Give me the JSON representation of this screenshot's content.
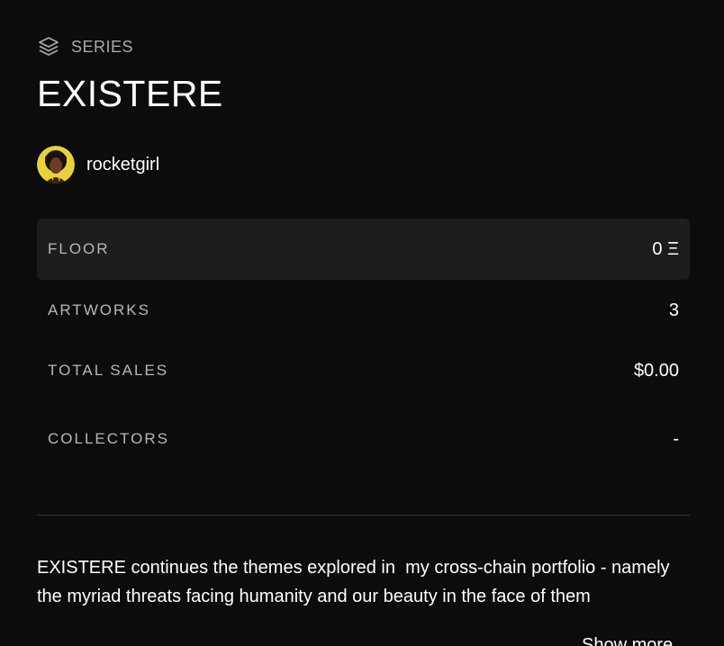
{
  "series": {
    "label": "SERIES",
    "icon": "layers-icon",
    "title": "EXISTERE"
  },
  "artist": {
    "name": "rocketgirl",
    "avatar_colors": {
      "ring": "#e8d23a",
      "skin": "#6b3b25",
      "hair": "#1a120c"
    }
  },
  "stats": [
    {
      "label": "FLOOR",
      "value": "0 Ξ",
      "highlight": true
    },
    {
      "label": "ARTWORKS",
      "value": "3",
      "highlight": false
    },
    {
      "label": "TOTAL SALES",
      "value": "$0.00",
      "highlight": false
    },
    {
      "label": "COLLECTORS",
      "value": "-",
      "highlight": false
    }
  ],
  "description": {
    "text": "EXISTERE continues the themes explored in  my cross-chain portfolio - namely the myriad threats facing humanity and our beauty in the face of them",
    "more_label": "Show more"
  },
  "colors": {
    "background": "#0c0c0c",
    "highlight_row": "#1d1d1d",
    "label": "#b7b7b7",
    "divider": "#333333"
  }
}
